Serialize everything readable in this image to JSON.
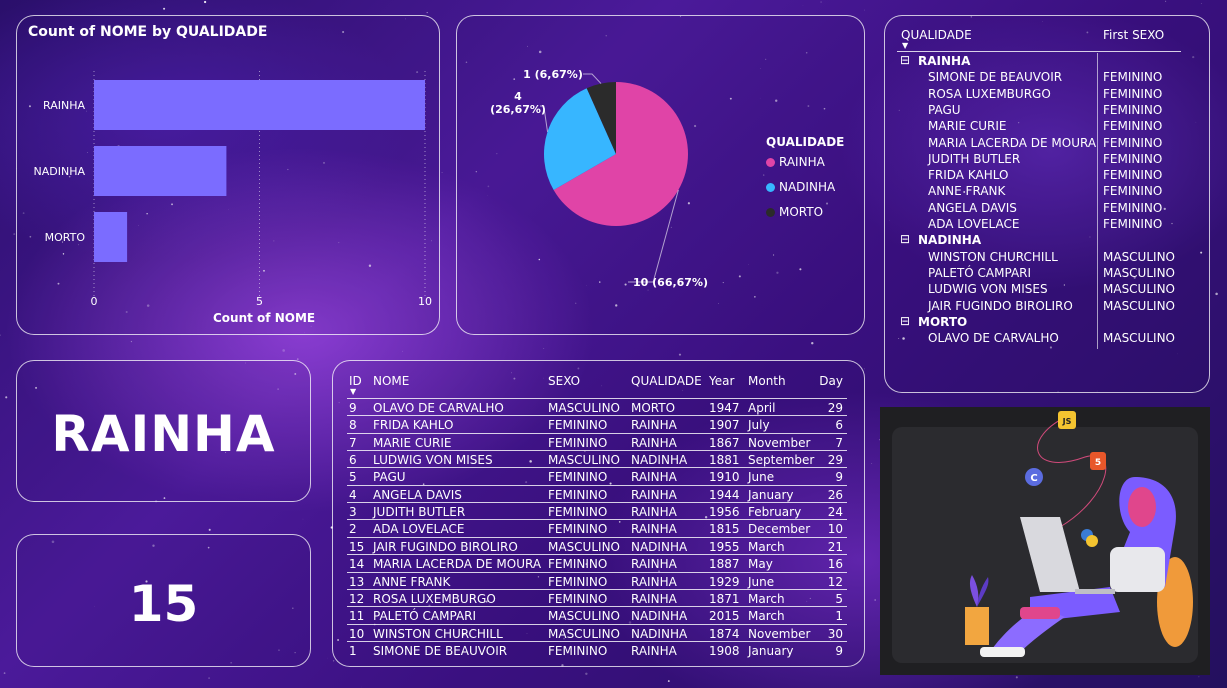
{
  "colors": {
    "rainha": "#e044a7",
    "nadinha": "#37b6ff",
    "morto": "#2b2b2b",
    "bar": "#7b6cff"
  },
  "bar_panel": {
    "title": "Count of NOME by QUALIDADE",
    "xlabel": "Count of NOME"
  },
  "pie_panel": {
    "legend_title": "QUALIDADE"
  },
  "chart_data": [
    {
      "type": "bar",
      "title": "Count of NOME by QUALIDADE",
      "xlabel": "Count of NOME",
      "ylabel": "",
      "categories": [
        "RAINHA",
        "NADINHA",
        "MORTO"
      ],
      "values": [
        10,
        4,
        1
      ],
      "xlim": [
        0,
        10
      ],
      "ticks": [
        "0",
        "5",
        "10"
      ],
      "grid": true
    },
    {
      "type": "pie",
      "legend_title": "QUALIDADE",
      "legend_position": "right",
      "categories": [
        "RAINHA",
        "NADINHA",
        "MORTO"
      ],
      "values": [
        10,
        4,
        1
      ],
      "labels": [
        "10 (66,67%)",
        "4 (26,67%)",
        "1 (6,67%)"
      ]
    }
  ],
  "matrix": {
    "headers": [
      "QUALIDADE",
      "First SEXO"
    ],
    "groups": [
      {
        "name": "RAINHA",
        "rows": [
          [
            "SIMONE DE BEAUVOIR",
            "FEMININO"
          ],
          [
            "ROSA LUXEMBURGO",
            "FEMININO"
          ],
          [
            "PAGU",
            "FEMININO"
          ],
          [
            "MARIE CURIE",
            "FEMININO"
          ],
          [
            "MARIA LACERDA DE MOURA",
            "FEMININO"
          ],
          [
            "JUDITH BUTLER",
            "FEMININO"
          ],
          [
            "FRIDA KAHLO",
            "FEMININO"
          ],
          [
            "ANNE FRANK",
            "FEMININO"
          ],
          [
            "ANGELA DAVIS",
            "FEMININO"
          ],
          [
            "ADA LOVELACE",
            "FEMININO"
          ]
        ]
      },
      {
        "name": "NADINHA",
        "rows": [
          [
            "WINSTON CHURCHILL",
            "MASCULINO"
          ],
          [
            "PALETÓ CAMPARI",
            "MASCULINO"
          ],
          [
            "LUDWIG VON MISES",
            "MASCULINO"
          ],
          [
            "JAIR FUGINDO BIROLIRO",
            "MASCULINO"
          ]
        ]
      },
      {
        "name": "MORTO",
        "rows": [
          [
            "OLAVO DE CARVALHO",
            "MASCULINO"
          ]
        ]
      }
    ]
  },
  "card_text": {
    "value": "RAINHA"
  },
  "card_count": {
    "value": "15"
  },
  "detail_table": {
    "headers": [
      "ID",
      "NOME",
      "SEXO",
      "QUALIDADE",
      "Year",
      "Month",
      "Day"
    ],
    "rows": [
      [
        "9",
        "OLAVO DE CARVALHO",
        "MASCULINO",
        "MORTO",
        "1947",
        "April",
        "29"
      ],
      [
        "8",
        "FRIDA KAHLO",
        "FEMININO",
        "RAINHA",
        "1907",
        "July",
        "6"
      ],
      [
        "7",
        "MARIE CURIE",
        "FEMININO",
        "RAINHA",
        "1867",
        "November",
        "7"
      ],
      [
        "6",
        "LUDWIG VON MISES",
        "MASCULINO",
        "NADINHA",
        "1881",
        "September",
        "29"
      ],
      [
        "5",
        "PAGU",
        "FEMININO",
        "RAINHA",
        "1910",
        "June",
        "9"
      ],
      [
        "4",
        "ANGELA DAVIS",
        "FEMININO",
        "RAINHA",
        "1944",
        "January",
        "26"
      ],
      [
        "3",
        "JUDITH BUTLER",
        "FEMININO",
        "RAINHA",
        "1956",
        "February",
        "24"
      ],
      [
        "2",
        "ADA LOVELACE",
        "FEMININO",
        "RAINHA",
        "1815",
        "December",
        "10"
      ],
      [
        "15",
        "JAIR FUGINDO BIROLIRO",
        "MASCULINO",
        "NADINHA",
        "1955",
        "March",
        "21"
      ],
      [
        "14",
        "MARIA LACERDA DE MOURA",
        "FEMININO",
        "RAINHA",
        "1887",
        "May",
        "16"
      ],
      [
        "13",
        "ANNE FRANK",
        "FEMININO",
        "RAINHA",
        "1929",
        "June",
        "12"
      ],
      [
        "12",
        "ROSA LUXEMBURGO",
        "FEMININO",
        "RAINHA",
        "1871",
        "March",
        "5"
      ],
      [
        "11",
        "PALETÓ CAMPARI",
        "MASCULINO",
        "NADINHA",
        "2015",
        "March",
        "1"
      ],
      [
        "10",
        "WINSTON CHURCHILL",
        "MASCULINO",
        "NADINHA",
        "1874",
        "November",
        "30"
      ],
      [
        "1",
        "SIMONE DE BEAUVOIR",
        "FEMININO",
        "RAINHA",
        "1908",
        "January",
        "9"
      ]
    ]
  },
  "illustration": {
    "badges": [
      "JS",
      "5",
      "C"
    ]
  }
}
